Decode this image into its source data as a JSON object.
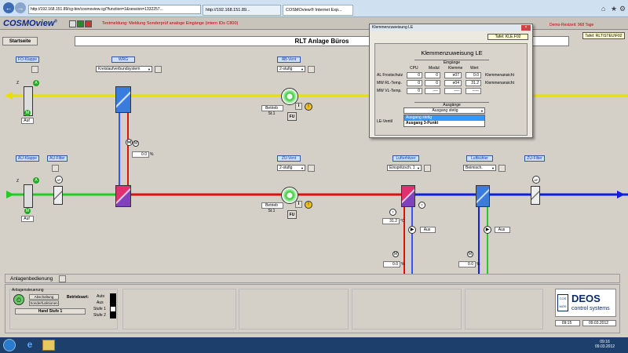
{
  "browser": {
    "address": "http://192.168.151.89/cg-bin/cosmoview.cgi?function=1&session=1332257...",
    "tab1": "http://192.168.151.89...",
    "tab2": "COSMOview® Internet Exp...",
    "back": "←",
    "fwd": "→"
  },
  "app": {
    "logo": "COSMOview",
    "logo_mark": "®",
    "message": "Textmeldung: Meldung Sonderprüf analoge Eingänge (intern IDs C800)",
    "demo": "Demo-Restzeit: 968 Tage",
    "date_top": "09.03.2012 09:15",
    "tafel_right": "Tafel: RLT\\STEU\\F02",
    "start_button": "Startseite",
    "page_title": "RLT Anlage Büros"
  },
  "schematic": {
    "fo_klappe": "FO-Klappe",
    "wrg": "WRG",
    "ab_vent": "AB-Vent",
    "wrg_select": "Kreislaufverbundsystem",
    "ab_select": "2-stufig",
    "betrieb_ab": "Betrieb St.1",
    "fu": "FU",
    "auf1": "Auf",
    "au_klappe": "AU-Klappe",
    "au_filter": "AU-Filter",
    "zu_vent": "ZU-Vent",
    "zu_select": "2-stufig",
    "lufterhitzer": "Lufterhitzer",
    "erhitzer_select": "Einspritzsch. 1",
    "luftkuehler": "Luftkühler",
    "kuehler_select": "Beimisch.",
    "zu_filter": "ZU-Filter",
    "betrieb_zu": "Betrieb St.1",
    "auf2": "Auf",
    "valve_wrg": "0.0",
    "pct": "%",
    "temp": "31.2",
    "degc": "°C",
    "aus1": "Aus",
    "aus2": "Aus",
    "valve_erh": "0.0",
    "valve_kue": "0.0",
    "dp": "ΔP",
    "m": "M",
    "t": "T",
    "a": "A",
    "z": "Z",
    "fan_label": "M"
  },
  "dialog": {
    "window_title": "Klemmenzuweisung LE",
    "tafel": "Tafel: KLE.F02",
    "heading": "Klemmenzuweisung LE",
    "eingaenge": "Eingänge",
    "cols": [
      "CPU",
      "Modul",
      "Klemme",
      "Wert"
    ],
    "rows": [
      {
        "name": "AL Frostschutz",
        "cpu": "0",
        "modul": "0",
        "klemme": "e07",
        "wert": "0.0",
        "action": "Klemmenansicht"
      },
      {
        "name": "MW RL-Temp.",
        "cpu": "0",
        "modul": "0",
        "klemme": "e04",
        "wert": "31.2",
        "action": "Klemmenansicht"
      },
      {
        "name": "MW VL-Temp.",
        "cpu": "0",
        "modul": "----",
        "klemme": "----",
        "wert": "-----",
        "action": ""
      }
    ],
    "ausgaenge": "Ausgänge",
    "out_selected": "Ausgang stetig",
    "out_options": [
      "Ausgang stetig",
      "Ausgang 3-Punkt"
    ],
    "le_ventil": "LE-Ventil"
  },
  "bottom": {
    "header": "Anlagenbedienung",
    "steuerung": "Anlagensteuerung",
    "abschaltung": "Abschaltung Vent.",
    "sonder": "Sonderfunktionen",
    "hand": "Hand Stufe 1",
    "betriebsart": "Betriebsart:",
    "modes": [
      "Auto",
      "Aus",
      "Stufe 1",
      "Stufe 2"
    ],
    "deos_small": "COS MOS",
    "deos": "DEOS",
    "deos_sub": "control systems",
    "time": "09:15",
    "date": "09.03.2012"
  },
  "taskbar": {
    "time": "09:16",
    "date": "09.03.2012"
  },
  "colors": {
    "exhaust": "#e8e000",
    "supply": "#dd1010",
    "fresh": "#22cc22",
    "cold": "#1020e0",
    "blue_pipe": "#3355ff",
    "msg": "#c00000"
  }
}
